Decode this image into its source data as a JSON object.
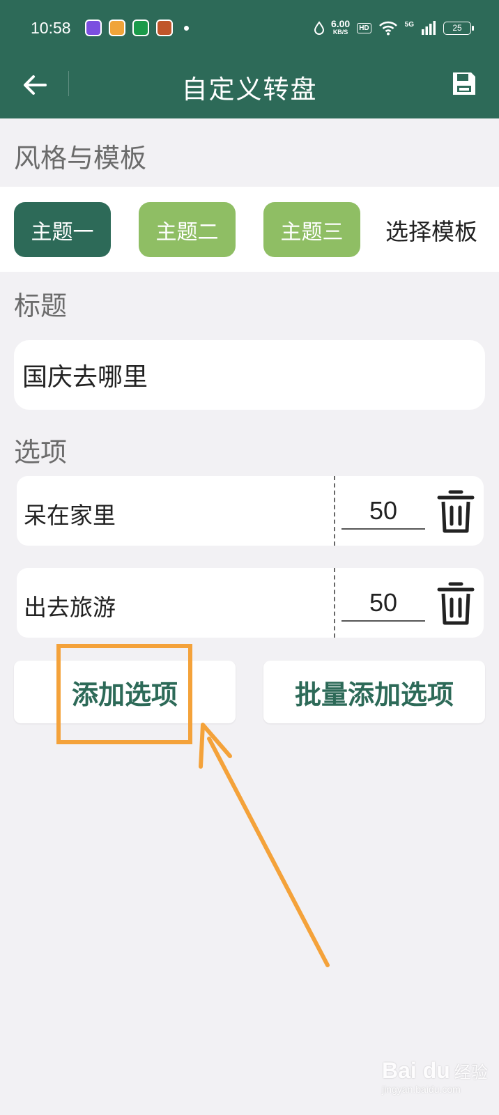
{
  "status_bar": {
    "time": "10:58",
    "notification_icons": [
      {
        "icon": "moon-app-icon",
        "color": "#7b4fe0"
      },
      {
        "icon": "orange-app-icon",
        "color": "#f0a43a"
      },
      {
        "icon": "oppo-app-icon",
        "color": "#1a9a4a",
        "text": "oppo"
      },
      {
        "icon": "checker-game-icon",
        "color": "#c0552a"
      }
    ],
    "net_speed_value": "6.00",
    "net_speed_unit": "KB/S",
    "hd_label": "HD",
    "signal_label": "5G",
    "battery_level": "25"
  },
  "toolbar": {
    "title": "自定义转盘",
    "back_icon": "arrow-left-icon",
    "save_icon": "floppy-disk-icon"
  },
  "style_section": {
    "label": "风格与模板",
    "themes": [
      {
        "label": "主题一",
        "active": true
      },
      {
        "label": "主题二",
        "active": false
      },
      {
        "label": "主题三",
        "active": false
      }
    ],
    "template_link": "选择模板"
  },
  "title_section": {
    "label": "标题",
    "value": "国庆去哪里"
  },
  "options_section": {
    "label": "选项",
    "items": [
      {
        "name": "呆在家里",
        "weight": "50"
      },
      {
        "name": "出去旅游",
        "weight": "50"
      }
    ]
  },
  "actions": {
    "add_option": "添加选项",
    "batch_add_option": "批量添加选项"
  },
  "watermark": {
    "logo": "Bai du",
    "text": "经验",
    "url": "jingyan.baidu.com"
  },
  "colors": {
    "primary": "#2d6a58",
    "theme_inactive": "#8fbe64",
    "highlight": "#f4a23a",
    "background": "#f2f1f4"
  }
}
